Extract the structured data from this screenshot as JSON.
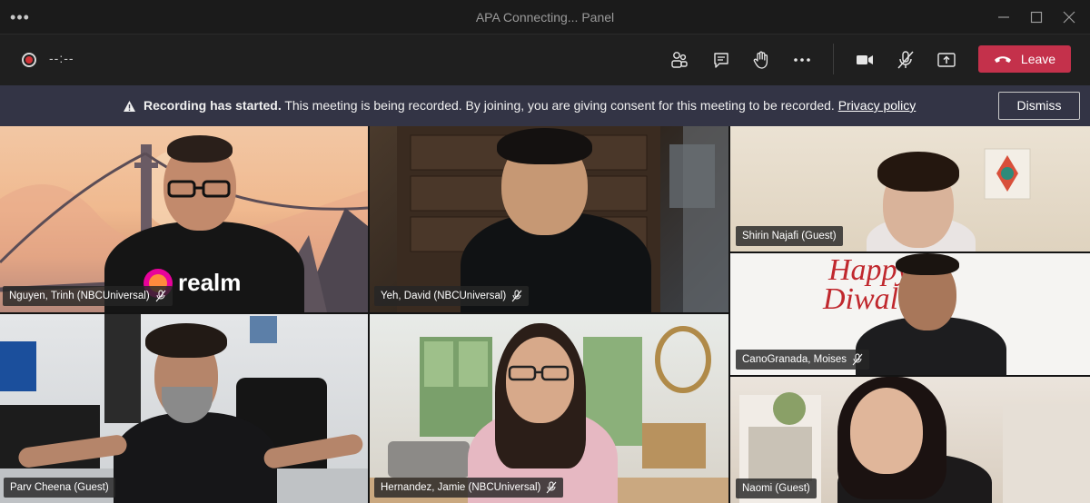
{
  "window": {
    "title": "APA Connecting... Panel"
  },
  "toolbar": {
    "timer": "--:--",
    "leave_label": "Leave"
  },
  "banner": {
    "bold_text": "Recording has started.",
    "text": " This meeting is being recorded. By joining, you are giving consent for this meeting to be recorded. ",
    "link_text": "Privacy policy",
    "dismiss_label": "Dismiss"
  },
  "participants": [
    {
      "name": "Nguyen, Trinh (NBCUniversal)",
      "muted": true
    },
    {
      "name": "Yeh, David (NBCUniversal)",
      "muted": true
    },
    {
      "name": "Shirin Najafi (Guest)",
      "muted": false
    },
    {
      "name": "CanoGranada, Moises",
      "muted": true
    },
    {
      "name": "Parv Cheena (Guest)",
      "muted": false
    },
    {
      "name": "Hernandez, Jamie (NBCUniversal)",
      "muted": true
    },
    {
      "name": "Naomi (Guest)",
      "muted": false
    }
  ],
  "shirt_texts": {
    "realm": "realm",
    "happy": "Happy",
    "diwali": "Diwali"
  },
  "colors": {
    "leave_button": "#c4314b",
    "banner_bg": "#333445",
    "record_dot": "#d13438"
  }
}
